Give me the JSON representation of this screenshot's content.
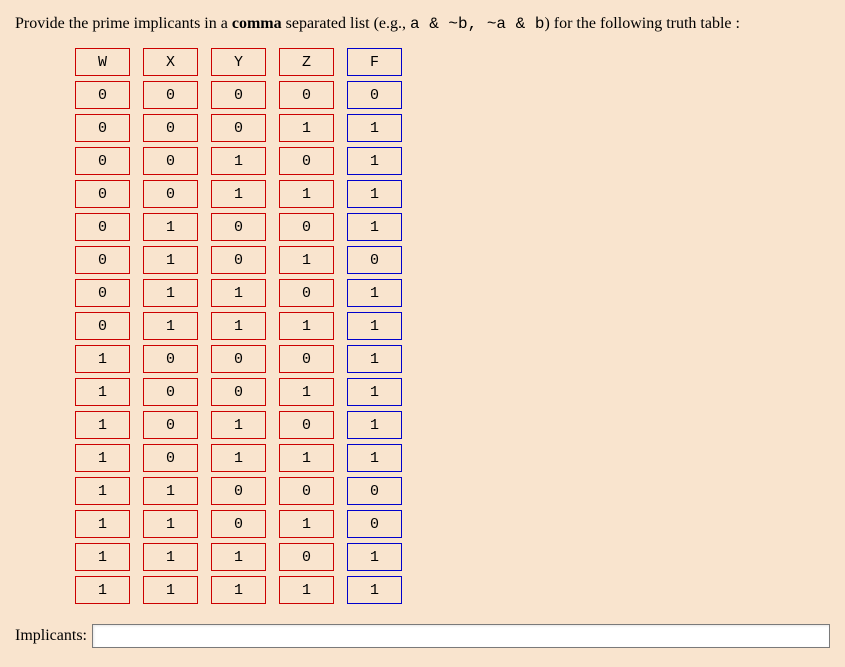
{
  "prompt": {
    "prefix": "Provide the prime implicants in a ",
    "bold": "comma",
    "mid": " separated list (e.g., ",
    "example": "a & ~b, ~a & b",
    "suffix": ") for the following truth table :"
  },
  "table": {
    "headers": [
      "W",
      "X",
      "Y",
      "Z",
      "F"
    ],
    "rows": [
      [
        "0",
        "0",
        "0",
        "0",
        "0"
      ],
      [
        "0",
        "0",
        "0",
        "1",
        "1"
      ],
      [
        "0",
        "0",
        "1",
        "0",
        "1"
      ],
      [
        "0",
        "0",
        "1",
        "1",
        "1"
      ],
      [
        "0",
        "1",
        "0",
        "0",
        "1"
      ],
      [
        "0",
        "1",
        "0",
        "1",
        "0"
      ],
      [
        "0",
        "1",
        "1",
        "0",
        "1"
      ],
      [
        "0",
        "1",
        "1",
        "1",
        "1"
      ],
      [
        "1",
        "0",
        "0",
        "0",
        "1"
      ],
      [
        "1",
        "0",
        "0",
        "1",
        "1"
      ],
      [
        "1",
        "0",
        "1",
        "0",
        "1"
      ],
      [
        "1",
        "0",
        "1",
        "1",
        "1"
      ],
      [
        "1",
        "1",
        "0",
        "0",
        "0"
      ],
      [
        "1",
        "1",
        "0",
        "1",
        "0"
      ],
      [
        "1",
        "1",
        "1",
        "0",
        "1"
      ],
      [
        "1",
        "1",
        "1",
        "1",
        "1"
      ]
    ]
  },
  "implicants": {
    "label": "Implicants:",
    "value": ""
  }
}
